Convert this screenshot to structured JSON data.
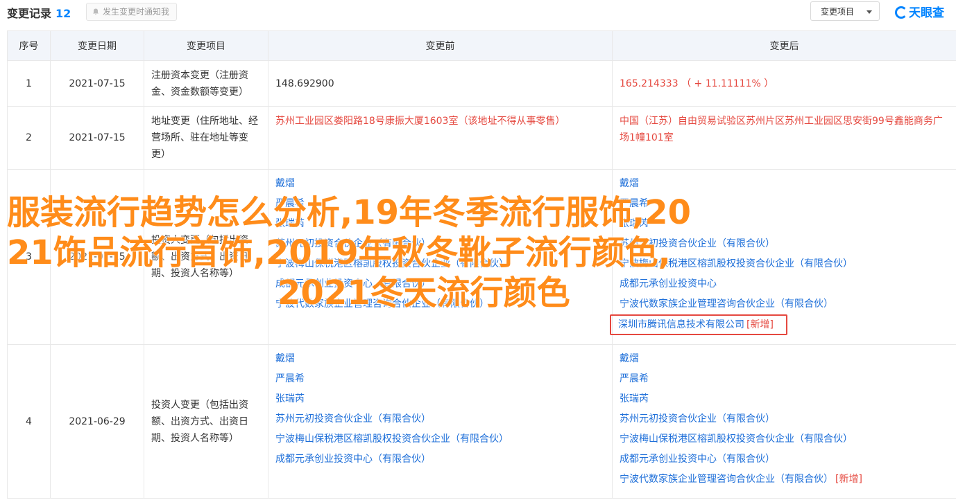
{
  "header": {
    "title": "变更记录",
    "count": "12",
    "notify_label": "发生变更时通知我",
    "filter_label": "变更项目",
    "logo_text": "天眼查"
  },
  "table": {
    "columns": [
      "序号",
      "变更日期",
      "变更项目",
      "变更前",
      "变更后"
    ],
    "rows": [
      {
        "no": "1",
        "date": "2021-07-15",
        "item": "注册资本变更（注册资金、资金数额等变更）",
        "before": "148.692900",
        "after": "165.214333 （ + 11.11111% ）"
      },
      {
        "no": "2",
        "date": "2021-07-15",
        "item": "地址变更（住所地址、经营场所、驻在地址等变更）",
        "before": "苏州工业园区娄阳路18号康振大厦1603室（该地址不得从事零售）",
        "after": "中国（江苏）自由贸易试验区苏州片区苏州工业园区思安街99号鑫能商务广场1幢101室"
      },
      {
        "no": "3",
        "date": "2021-07-15",
        "item": "投资人变更（包括出资额、出资方式、出资日期、投资人名称等）",
        "before": [
          "戴熠",
          "严晨希",
          "张瑞芮",
          "苏州元初投资合伙企业（有限合伙）",
          "宁波梅山保税港区榕凯股权投资合伙企业（有限合伙）",
          "成都元承创业投资中心（有限合伙）",
          "宁波代数家族企业管理咨询合伙企业（有限合伙）"
        ],
        "after": [
          "戴熠",
          "严晨希",
          "张瑞芮",
          "苏州元初投资合伙企业（有限合伙）",
          "宁波梅山保税港区榕凯股权投资合伙企业（有限合伙）",
          "成都元承创业投资中心",
          "宁波代数家族企业管理咨询合伙企业（有限合伙）"
        ],
        "after_new": "深圳市腾讯信息技术有限公司",
        "new_tag": "[新增]"
      },
      {
        "no": "4",
        "date": "2021-06-29",
        "item": "投资人变更（包括出资额、出资方式、出资日期、投资人名称等）",
        "before": [
          "戴熠",
          "严晨希",
          "张瑞芮",
          "苏州元初投资合伙企业（有限合伙）",
          "宁波梅山保税港区榕凯股权投资合伙企业（有限合伙）",
          "成都元承创业投资中心（有限合伙）"
        ],
        "after": [
          "戴熠",
          "严晨希",
          "张瑞芮",
          "苏州元初投资合伙企业（有限合伙）",
          "宁波梅山保税港区榕凯股权投资合伙企业（有限合伙）",
          "成都元承创业投资中心（有限合伙）"
        ],
        "after_last": "宁波代数家族企业管理咨询合伙企业（有限合伙）",
        "new_tag": "[新增]"
      }
    ]
  },
  "overlay": {
    "line1": "服装流行趋势怎么分析,19年冬季流行服饰,20",
    "line2": "21饰品流行首饰,2019年秋冬靴子流行颜色,",
    "line3": "2021冬天流行颜色"
  },
  "colors": {
    "accent": "#0084ff",
    "red": "#e5483f",
    "overlay": "#ff8c1a"
  }
}
